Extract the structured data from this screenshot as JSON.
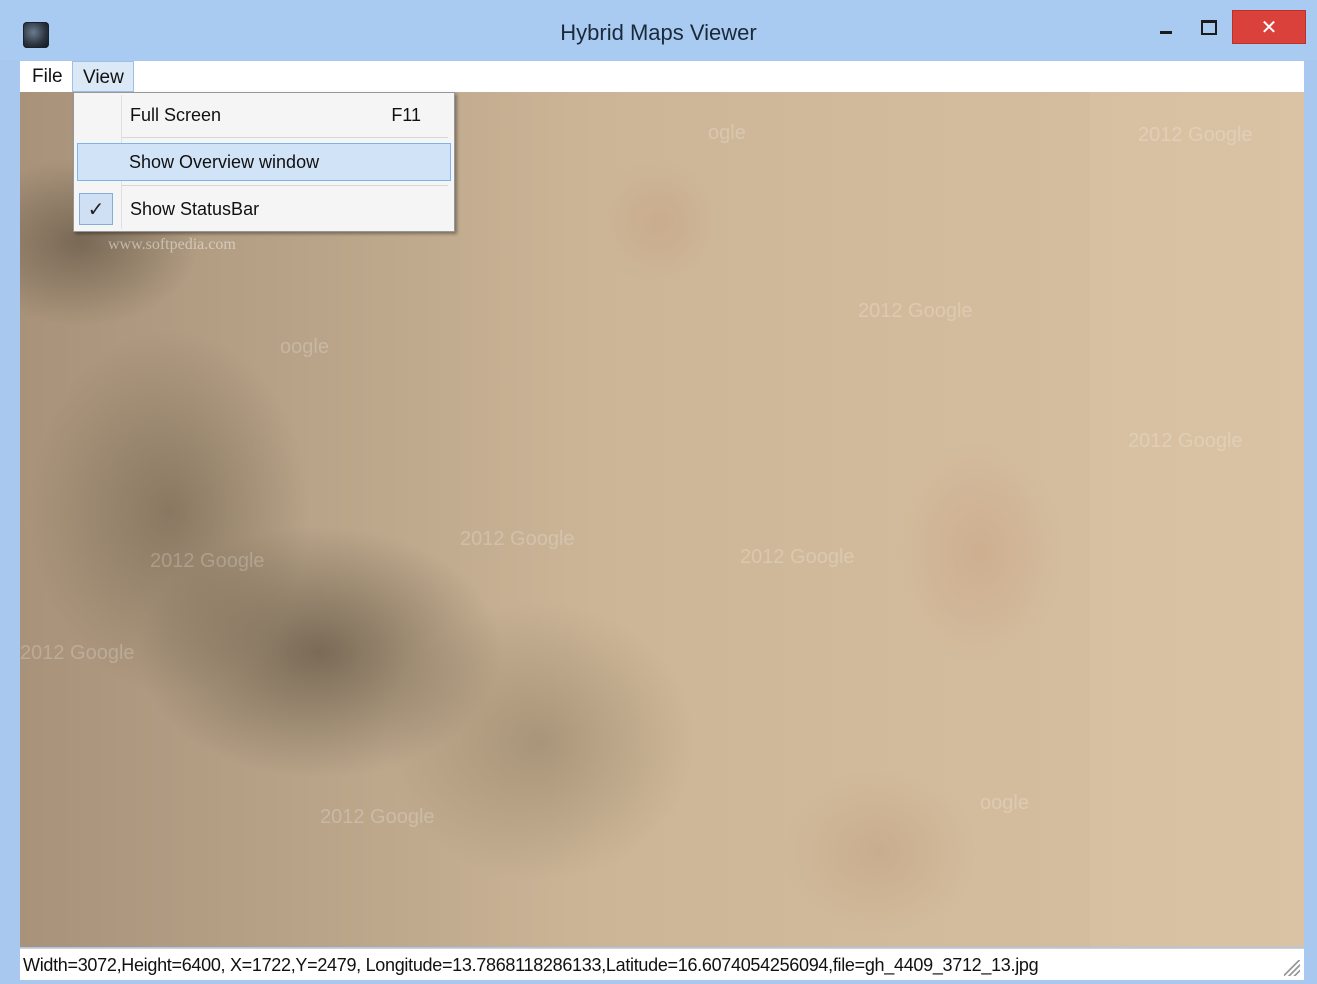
{
  "window": {
    "title": "Hybrid Maps Viewer",
    "icon": "globe-icon",
    "controls": {
      "minimize": "minimize-icon",
      "maximize": "maximize-icon",
      "close_label": "✕"
    }
  },
  "menubar": {
    "items": [
      {
        "label": "File"
      },
      {
        "label": "View"
      }
    ]
  },
  "view_menu": {
    "items": [
      {
        "label": "Full Screen",
        "shortcut": "F11",
        "checked": false
      },
      {
        "label": "Show Overview window",
        "shortcut": "",
        "checked": false,
        "highlighted": true
      },
      {
        "label": "Show StatusBar",
        "shortcut": "",
        "checked": true,
        "check_glyph": "✓"
      }
    ]
  },
  "map": {
    "watermark_text": "2012 Google",
    "watermarks": [
      "ogle",
      "2012 Google",
      "2012 Google",
      "oogle",
      "2012 Google",
      "2012 Google",
      "2012 Google",
      "2012 Google",
      "2012 Google",
      "2012 Google",
      "oogle"
    ],
    "softpedia_url": "www.softpedia.com",
    "colors": {
      "sand": "#d2bb9c",
      "dark_terrain": "#5a4e3a"
    }
  },
  "statusbar": {
    "text": "Width=3072,Height=6400, X=1722,Y=2479, Longitude=13.7868118286133,Latitude=16.6074054256094,file=gh_4409_3712_13.jpg"
  },
  "colors": {
    "titlebar": "#a9cbf1",
    "close_button": "#d9413a",
    "menu_highlight": "#d1e3f7"
  }
}
